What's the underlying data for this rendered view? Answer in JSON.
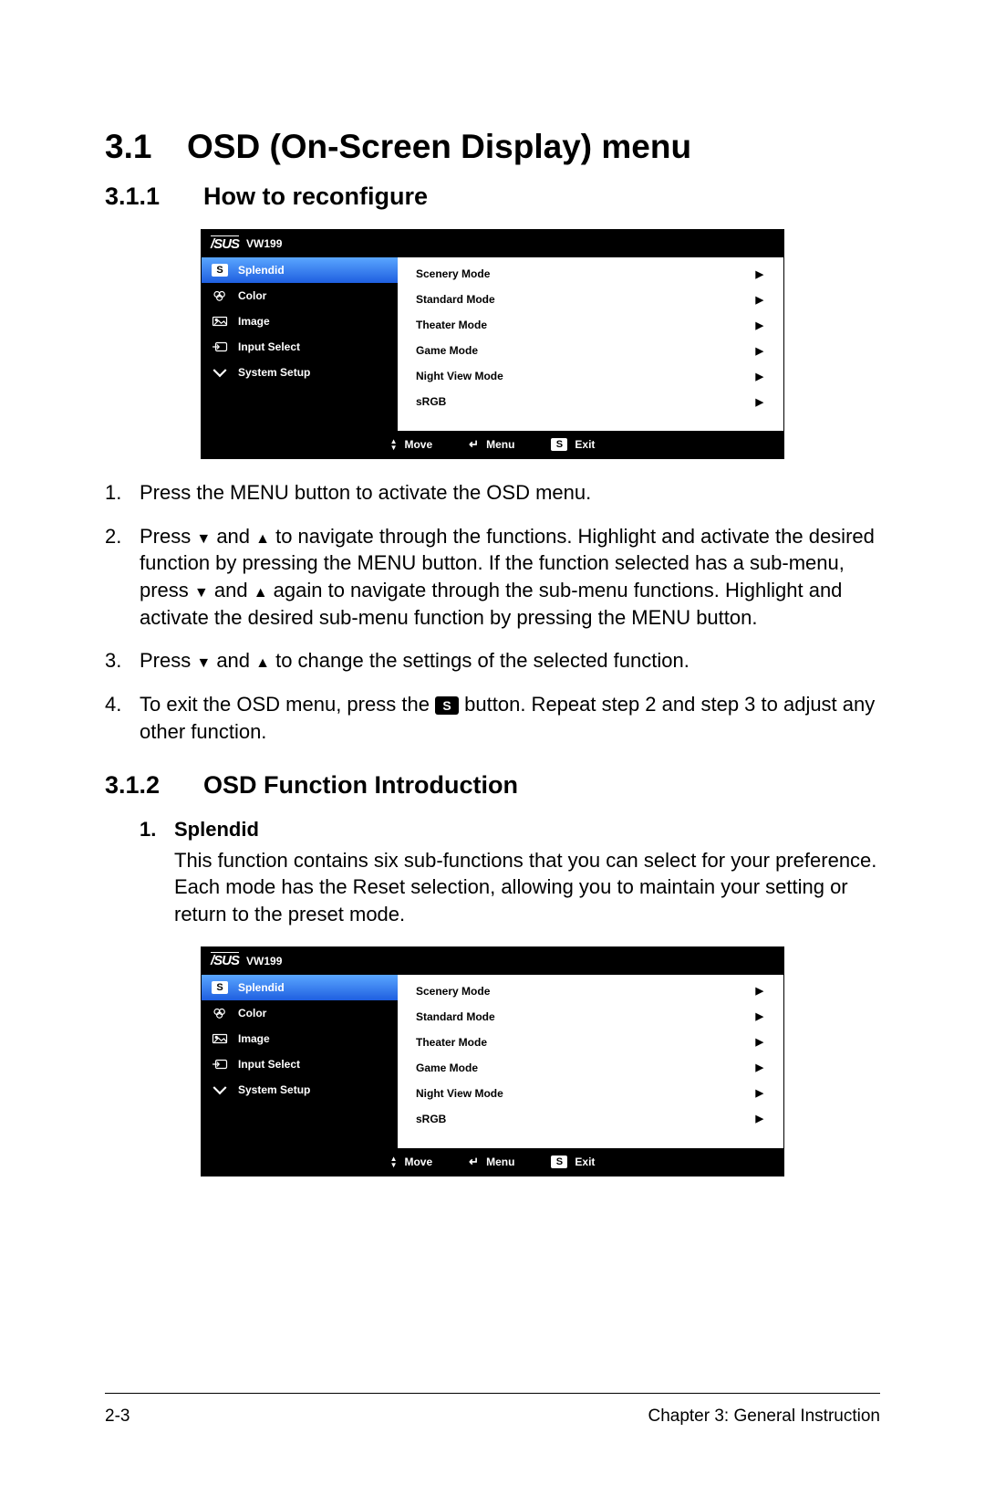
{
  "page": {
    "h1_num": "3.1",
    "h1_text": "OSD (On-Screen Display) menu",
    "h2a_num": "3.1.1",
    "h2a_text": "How to reconfigure",
    "h2b_num": "3.1.2",
    "h2b_text": "OSD Function Introduction",
    "h3_num": "1.",
    "h3_text": "Splendid",
    "splendid_para": "This function contains six sub-functions that you can select for your preference. Each mode has the Reset selection, allowing you to maintain your setting or return to the preset mode.",
    "footer_left": "2-3",
    "footer_right": "Chapter 3: General Instruction"
  },
  "steps": {
    "s1_num": "1.",
    "s1_body": "Press the MENU button to activate the OSD menu.",
    "s2_num": "2.",
    "s2_a": "Press ",
    "s2_b": " and ",
    "s2_c": " to navigate through the functions. Highlight and activate the desired function by pressing the MENU button. If the function selected has a sub-menu, press ",
    "s2_d": " and ",
    "s2_e": " again to navigate through the sub-menu functions. Highlight and activate the desired sub-menu function by pressing the MENU button.",
    "s3_num": "3.",
    "s3_a": "Press ",
    "s3_b": " and ",
    "s3_c": " to change the settings of the selected function.",
    "s4_num": "4.",
    "s4_a": "To exit the OSD menu, press the ",
    "s4_b": " button. Repeat step 2 and step 3 to adjust any other function.",
    "s4_badge": "S"
  },
  "osd": {
    "brand": "/SUS",
    "model": "VW199",
    "left": {
      "i0": "Splendid",
      "i1": "Color",
      "i2": "Image",
      "i3": "Input Select",
      "i4": "System Setup"
    },
    "left_s_badge": "S",
    "right": {
      "r0": "Scenery Mode",
      "r1": "Standard Mode",
      "r2": "Theater Mode",
      "r3": "Game Mode",
      "r4": "Night View Mode",
      "r5": "sRGB"
    },
    "footer": {
      "move": "Move",
      "menu": "Menu",
      "exit": "Exit",
      "s_badge": "S"
    }
  }
}
